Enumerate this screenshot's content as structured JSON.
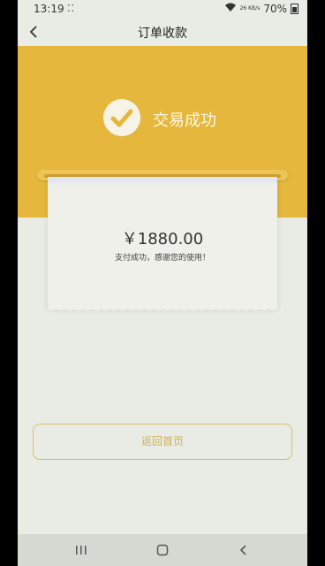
{
  "status": {
    "time": "13:19",
    "dots": "⁚⁚",
    "net": "26 KB/s",
    "battery": "70%"
  },
  "header": {
    "title": "订单收款"
  },
  "hero": {
    "success_text": "交易成功"
  },
  "receipt": {
    "amount": "￥1880.00",
    "message": "支付成功，感谢您的使用！"
  },
  "actions": {
    "home_label": "返回首页"
  },
  "icons": {
    "back": "back-arrow-icon",
    "check": "check-icon",
    "recents": "recents-icon",
    "home": "home-icon",
    "nav_back": "nav-back-icon"
  },
  "colors": {
    "accent": "#e5b73c",
    "button_border": "#dcbf62",
    "background": "#e9ece4"
  }
}
